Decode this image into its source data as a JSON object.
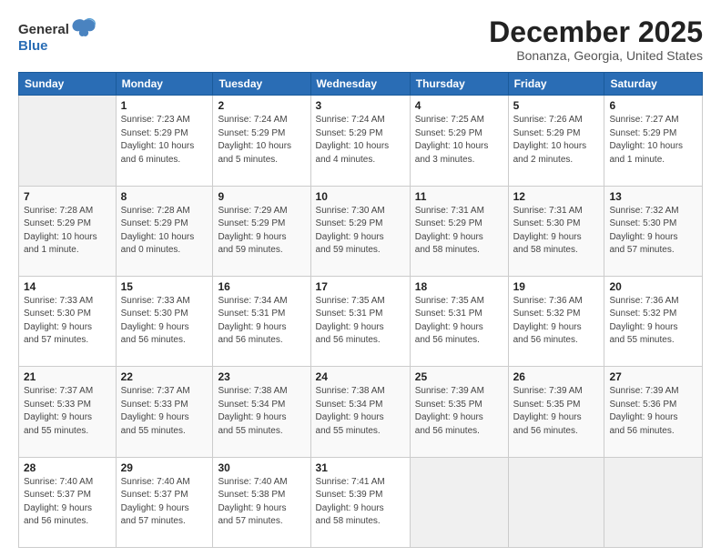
{
  "header": {
    "logo_general": "General",
    "logo_blue": "Blue",
    "title": "December 2025",
    "subtitle": "Bonanza, Georgia, United States"
  },
  "calendar": {
    "days_of_week": [
      "Sunday",
      "Monday",
      "Tuesday",
      "Wednesday",
      "Thursday",
      "Friday",
      "Saturday"
    ],
    "weeks": [
      [
        {
          "day": "",
          "info": ""
        },
        {
          "day": "1",
          "info": "Sunrise: 7:23 AM\nSunset: 5:29 PM\nDaylight: 10 hours\nand 6 minutes."
        },
        {
          "day": "2",
          "info": "Sunrise: 7:24 AM\nSunset: 5:29 PM\nDaylight: 10 hours\nand 5 minutes."
        },
        {
          "day": "3",
          "info": "Sunrise: 7:24 AM\nSunset: 5:29 PM\nDaylight: 10 hours\nand 4 minutes."
        },
        {
          "day": "4",
          "info": "Sunrise: 7:25 AM\nSunset: 5:29 PM\nDaylight: 10 hours\nand 3 minutes."
        },
        {
          "day": "5",
          "info": "Sunrise: 7:26 AM\nSunset: 5:29 PM\nDaylight: 10 hours\nand 2 minutes."
        },
        {
          "day": "6",
          "info": "Sunrise: 7:27 AM\nSunset: 5:29 PM\nDaylight: 10 hours\nand 1 minute."
        }
      ],
      [
        {
          "day": "7",
          "info": "Sunrise: 7:28 AM\nSunset: 5:29 PM\nDaylight: 10 hours\nand 1 minute."
        },
        {
          "day": "8",
          "info": "Sunrise: 7:28 AM\nSunset: 5:29 PM\nDaylight: 10 hours\nand 0 minutes."
        },
        {
          "day": "9",
          "info": "Sunrise: 7:29 AM\nSunset: 5:29 PM\nDaylight: 9 hours\nand 59 minutes."
        },
        {
          "day": "10",
          "info": "Sunrise: 7:30 AM\nSunset: 5:29 PM\nDaylight: 9 hours\nand 59 minutes."
        },
        {
          "day": "11",
          "info": "Sunrise: 7:31 AM\nSunset: 5:29 PM\nDaylight: 9 hours\nand 58 minutes."
        },
        {
          "day": "12",
          "info": "Sunrise: 7:31 AM\nSunset: 5:30 PM\nDaylight: 9 hours\nand 58 minutes."
        },
        {
          "day": "13",
          "info": "Sunrise: 7:32 AM\nSunset: 5:30 PM\nDaylight: 9 hours\nand 57 minutes."
        }
      ],
      [
        {
          "day": "14",
          "info": "Sunrise: 7:33 AM\nSunset: 5:30 PM\nDaylight: 9 hours\nand 57 minutes."
        },
        {
          "day": "15",
          "info": "Sunrise: 7:33 AM\nSunset: 5:30 PM\nDaylight: 9 hours\nand 56 minutes."
        },
        {
          "day": "16",
          "info": "Sunrise: 7:34 AM\nSunset: 5:31 PM\nDaylight: 9 hours\nand 56 minutes."
        },
        {
          "day": "17",
          "info": "Sunrise: 7:35 AM\nSunset: 5:31 PM\nDaylight: 9 hours\nand 56 minutes."
        },
        {
          "day": "18",
          "info": "Sunrise: 7:35 AM\nSunset: 5:31 PM\nDaylight: 9 hours\nand 56 minutes."
        },
        {
          "day": "19",
          "info": "Sunrise: 7:36 AM\nSunset: 5:32 PM\nDaylight: 9 hours\nand 56 minutes."
        },
        {
          "day": "20",
          "info": "Sunrise: 7:36 AM\nSunset: 5:32 PM\nDaylight: 9 hours\nand 55 minutes."
        }
      ],
      [
        {
          "day": "21",
          "info": "Sunrise: 7:37 AM\nSunset: 5:33 PM\nDaylight: 9 hours\nand 55 minutes."
        },
        {
          "day": "22",
          "info": "Sunrise: 7:37 AM\nSunset: 5:33 PM\nDaylight: 9 hours\nand 55 minutes."
        },
        {
          "day": "23",
          "info": "Sunrise: 7:38 AM\nSunset: 5:34 PM\nDaylight: 9 hours\nand 55 minutes."
        },
        {
          "day": "24",
          "info": "Sunrise: 7:38 AM\nSunset: 5:34 PM\nDaylight: 9 hours\nand 55 minutes."
        },
        {
          "day": "25",
          "info": "Sunrise: 7:39 AM\nSunset: 5:35 PM\nDaylight: 9 hours\nand 56 minutes."
        },
        {
          "day": "26",
          "info": "Sunrise: 7:39 AM\nSunset: 5:35 PM\nDaylight: 9 hours\nand 56 minutes."
        },
        {
          "day": "27",
          "info": "Sunrise: 7:39 AM\nSunset: 5:36 PM\nDaylight: 9 hours\nand 56 minutes."
        }
      ],
      [
        {
          "day": "28",
          "info": "Sunrise: 7:40 AM\nSunset: 5:37 PM\nDaylight: 9 hours\nand 56 minutes."
        },
        {
          "day": "29",
          "info": "Sunrise: 7:40 AM\nSunset: 5:37 PM\nDaylight: 9 hours\nand 57 minutes."
        },
        {
          "day": "30",
          "info": "Sunrise: 7:40 AM\nSunset: 5:38 PM\nDaylight: 9 hours\nand 57 minutes."
        },
        {
          "day": "31",
          "info": "Sunrise: 7:41 AM\nSunset: 5:39 PM\nDaylight: 9 hours\nand 58 minutes."
        },
        {
          "day": "",
          "info": ""
        },
        {
          "day": "",
          "info": ""
        },
        {
          "day": "",
          "info": ""
        }
      ]
    ]
  }
}
